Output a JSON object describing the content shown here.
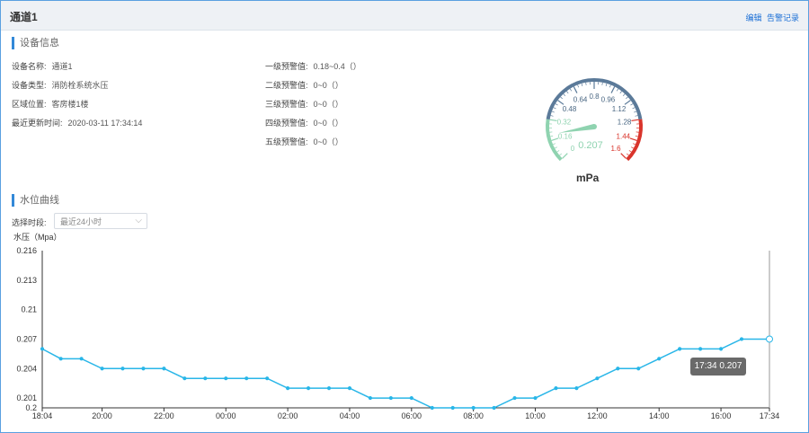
{
  "window": {
    "title": "通道1",
    "actions": [
      "编辑",
      "告警记录"
    ]
  },
  "device": {
    "section_title": "设备信息",
    "fields": [
      {
        "key": "设备名称:",
        "value": "通道1"
      },
      {
        "key": "设备类型:",
        "value": "消防栓系统水压"
      },
      {
        "key": "区域位置:",
        "value": "客房楼1楼"
      },
      {
        "key": "最近更新时间:",
        "value": "2020-03-11 17:34:14"
      }
    ],
    "alarms": [
      {
        "key": "一级预警值:",
        "value": "0.18~0.4（）"
      },
      {
        "key": "二级预警值:",
        "value": "0~0（）"
      },
      {
        "key": "三级预警值:",
        "value": "0~0（）"
      },
      {
        "key": "四级预警值:",
        "value": "0~0（）"
      },
      {
        "key": "五级预警值:",
        "value": "0~0（）"
      }
    ]
  },
  "gauge": {
    "value": 0.207,
    "value_label": "0.207",
    "unit": "mPa",
    "min": 0,
    "max": 1.6,
    "ticks": [
      "0",
      "0.16",
      "0.32",
      "0.48",
      "0.64",
      "0.8",
      "0.96",
      "1.12",
      "1.28",
      "1.44",
      "1.6"
    ],
    "colors": {
      "low": "#8fd3b0",
      "mid": "#5b7a99",
      "high": "#d9342b",
      "needle": "#8fd3b0"
    }
  },
  "curve": {
    "section_title": "水位曲线",
    "select_label": "选择时段:",
    "select_value": "最近24小时",
    "tooltip": "17:34 0.207"
  },
  "chart_data": {
    "type": "line",
    "ylabel": "水压（Mpa）",
    "ylim": [
      0.2,
      0.216
    ],
    "yticks": [
      "0.2",
      "0.201",
      "0.204",
      "0.207",
      "0.21",
      "0.213",
      "0.216"
    ],
    "xticks": [
      "18:04",
      "20:00",
      "22:00",
      "00:00",
      "02:00",
      "04:00",
      "06:00",
      "08:00",
      "10:00",
      "12:00",
      "14:00",
      "16:00",
      "17:34"
    ],
    "x": [
      "18:04",
      "18:40",
      "19:20",
      "20:00",
      "20:40",
      "21:20",
      "22:00",
      "22:40",
      "23:20",
      "00:00",
      "00:40",
      "01:20",
      "02:00",
      "02:40",
      "03:20",
      "04:00",
      "04:40",
      "05:20",
      "06:00",
      "06:40",
      "07:20",
      "08:00",
      "08:40",
      "09:20",
      "10:00",
      "10:40",
      "11:20",
      "12:00",
      "12:40",
      "13:20",
      "14:00",
      "14:40",
      "15:20",
      "16:00",
      "16:40",
      "17:34"
    ],
    "series": [
      {
        "values": [
          0.206,
          0.205,
          0.205,
          0.204,
          0.204,
          0.204,
          0.204,
          0.203,
          0.203,
          0.203,
          0.203,
          0.203,
          0.202,
          0.202,
          0.202,
          0.202,
          0.201,
          0.201,
          0.201,
          0.2,
          0.2,
          0.2,
          0.2,
          0.201,
          0.201,
          0.202,
          0.202,
          0.203,
          0.204,
          0.204,
          0.205,
          0.206,
          0.206,
          0.206,
          0.207,
          0.207
        ],
        "color": "#29b6e8"
      }
    ]
  }
}
